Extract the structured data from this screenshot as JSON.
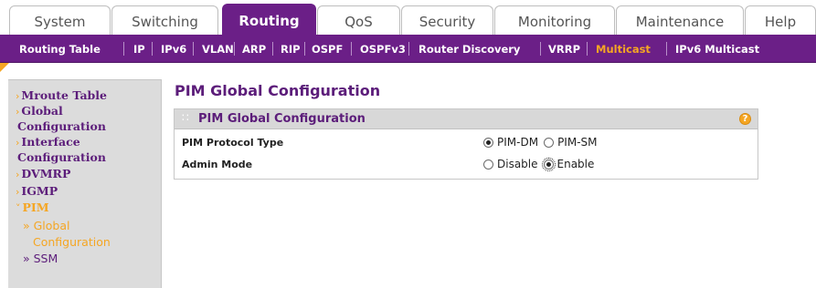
{
  "tabs": [
    {
      "label": "System",
      "active": false
    },
    {
      "label": "Switching",
      "active": false
    },
    {
      "label": "Routing",
      "active": true
    },
    {
      "label": "QoS",
      "active": false
    },
    {
      "label": "Security",
      "active": false
    },
    {
      "label": "Monitoring",
      "active": false
    },
    {
      "label": "Maintenance",
      "active": false
    },
    {
      "label": "Help",
      "active": false
    }
  ],
  "subnav": [
    {
      "label": "Routing Table",
      "active": false
    },
    {
      "label": "IP",
      "active": false
    },
    {
      "label": "IPv6",
      "active": false
    },
    {
      "label": "VLAN",
      "active": false
    },
    {
      "label": "ARP",
      "active": false
    },
    {
      "label": "RIP",
      "active": false
    },
    {
      "label": "OSPF",
      "active": false
    },
    {
      "label": "OSPFv3",
      "active": false
    },
    {
      "label": "Router Discovery",
      "active": false
    },
    {
      "label": "VRRP",
      "active": false
    },
    {
      "label": "Multicast",
      "active": true
    },
    {
      "label": "IPv6 Multicast",
      "active": false
    }
  ],
  "sidebar": {
    "items": [
      {
        "label": "Mroute Table"
      },
      {
        "label": "Global"
      },
      {
        "label": "Configuration"
      },
      {
        "label": "Interface"
      },
      {
        "label": "Configuration"
      },
      {
        "label": "DVMRP"
      },
      {
        "label": "IGMP"
      },
      {
        "label": "PIM"
      }
    ],
    "subitems": [
      {
        "label": "» Global"
      },
      {
        "label": "Configuration"
      },
      {
        "label": "» SSM"
      }
    ],
    "bullet_closed": "›",
    "bullet_open": "˅"
  },
  "main": {
    "page_title": "PIM Global Configuration",
    "panel_title": "PIM Global Configuration",
    "help_symbol": "?",
    "rows": [
      {
        "label": "PIM Protocol Type",
        "options": [
          {
            "label": "PIM-DM",
            "checked": true
          },
          {
            "label": "PIM-SM",
            "checked": false
          }
        ]
      },
      {
        "label": "Admin Mode",
        "options": [
          {
            "label": "Disable",
            "checked": false
          },
          {
            "label": "Enable",
            "checked": true
          }
        ]
      }
    ]
  },
  "colors": {
    "brand_purple": "#6b1f87",
    "accent_orange": "#f5a623",
    "sidebar_bg": "#dcdcdc"
  }
}
